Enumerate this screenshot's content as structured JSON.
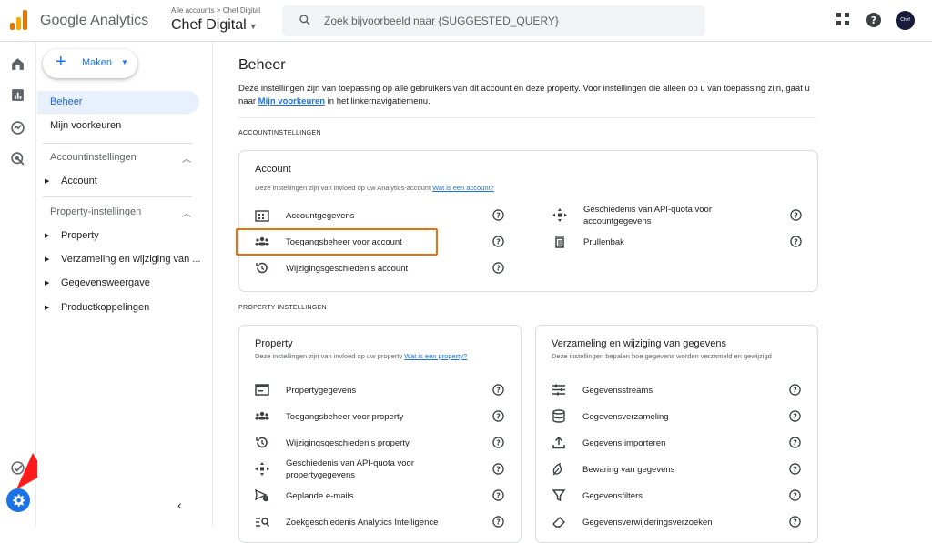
{
  "topbar": {
    "brand": "Google Analytics",
    "breadcrumb": "Alle accounts > Chef Digital",
    "account_name": "Chef Digital",
    "search_placeholder": "Zoek bijvoorbeeld naar {SUGGESTED_QUERY}",
    "avatar_text": "Chef Digital"
  },
  "sidebar": {
    "create_button": "Maken",
    "active_item": "Beheer",
    "preferences": "Mijn voorkeuren",
    "account_group": "Accountinstellingen",
    "account_items": [
      "Account"
    ],
    "property_group": "Property-instellingen",
    "property_items": [
      "Property",
      "Verzameling en wijziging van ...",
      "Gegevensweergave",
      "Productkoppelingen"
    ]
  },
  "main": {
    "title": "Beheer",
    "intro_text": "Deze instellingen zijn van toepassing op alle gebruikers van dit account en deze property. Voor instellingen die alleen op u van toepassing zijn, gaat u naar ",
    "intro_link": "Mijn voorkeuren",
    "intro_suffix": " in het linkernavigatiemenu.",
    "account_section": "ACCOUNTINSTELLINGEN",
    "property_section": "PROPERTY-INSTELLINGEN",
    "account_card": {
      "title": "Account",
      "desc": "Deze instellingen zijn van invloed op uw Analytics-account ",
      "desc_link": "Wat is een account?",
      "left": [
        "Accountgegevens",
        "Toegangsbeheer voor account",
        "Wijzigingsgeschiedenis account"
      ],
      "right": [
        "Geschiedenis van API-quota voor accountgegevens",
        "Prullenbak"
      ]
    },
    "property_card": {
      "title": "Property",
      "desc": "Deze instellingen zijn van invloed op uw property ",
      "desc_link": "Wat is een property?",
      "items": [
        "Propertygegevens",
        "Toegangsbeheer voor property",
        "Wijzigingsgeschiedenis property",
        "Geschiedenis van API-quota voor propertygegevens",
        "Geplande e-mails",
        "Zoekgeschiedenis Analytics Intelligence"
      ]
    },
    "data_card": {
      "title": "Verzameling en wijziging van gegevens",
      "desc": "Deze instellingen bepalen hoe gegevens worden verzameld en gewijzigd",
      "items": [
        "Gegevensstreams",
        "Gegevensverzameling",
        "Gegevens importeren",
        "Bewaring van gegevens",
        "Gegevensfilters",
        "Gegevensverwijderingsverzoeken"
      ]
    }
  },
  "colors": {
    "accent": "#1a73e8",
    "highlight": "#e8710a",
    "arrow": "#ff1a1a"
  }
}
